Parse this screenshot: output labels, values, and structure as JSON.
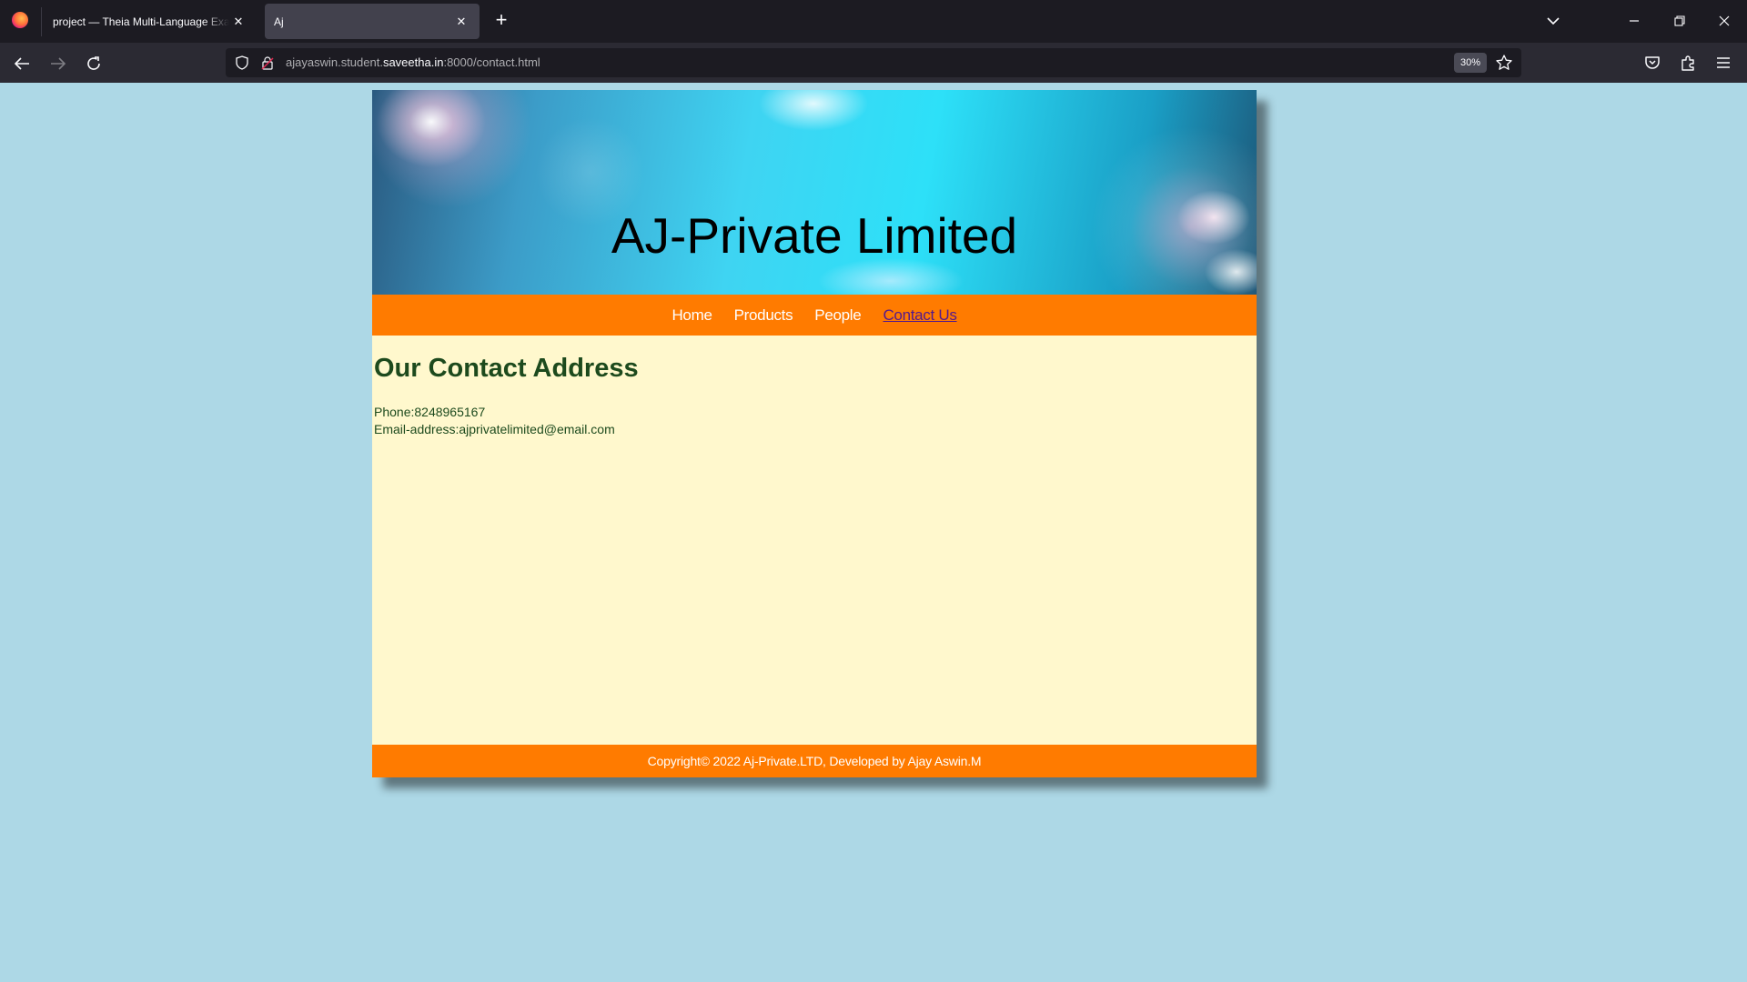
{
  "browser": {
    "tabs": [
      {
        "title": "project — Theia Multi-Language Exam"
      },
      {
        "title": "Aj"
      }
    ],
    "url": {
      "prefix": "ajayaswin.student.",
      "domain": "saveetha.in",
      "suffix": ":8000/contact.html"
    },
    "zoom": "30%"
  },
  "site": {
    "title": "AJ-Private Limited",
    "nav": [
      {
        "label": "Home"
      },
      {
        "label": "Products"
      },
      {
        "label": "People"
      },
      {
        "label": "Contact Us",
        "active": true
      }
    ],
    "heading": "Our Contact Address",
    "phone": "Phone:8248965167",
    "email": "Email-address:ajprivatelimited@email.com",
    "footer": "Copyright© 2022 Aj-Private.LTD, Developed by Ajay Aswin.M"
  },
  "colors": {
    "page_bg": "#add8e6",
    "accent": "#ff7b00",
    "content_bg": "#fff8cd",
    "text": "#1d4a1d"
  }
}
